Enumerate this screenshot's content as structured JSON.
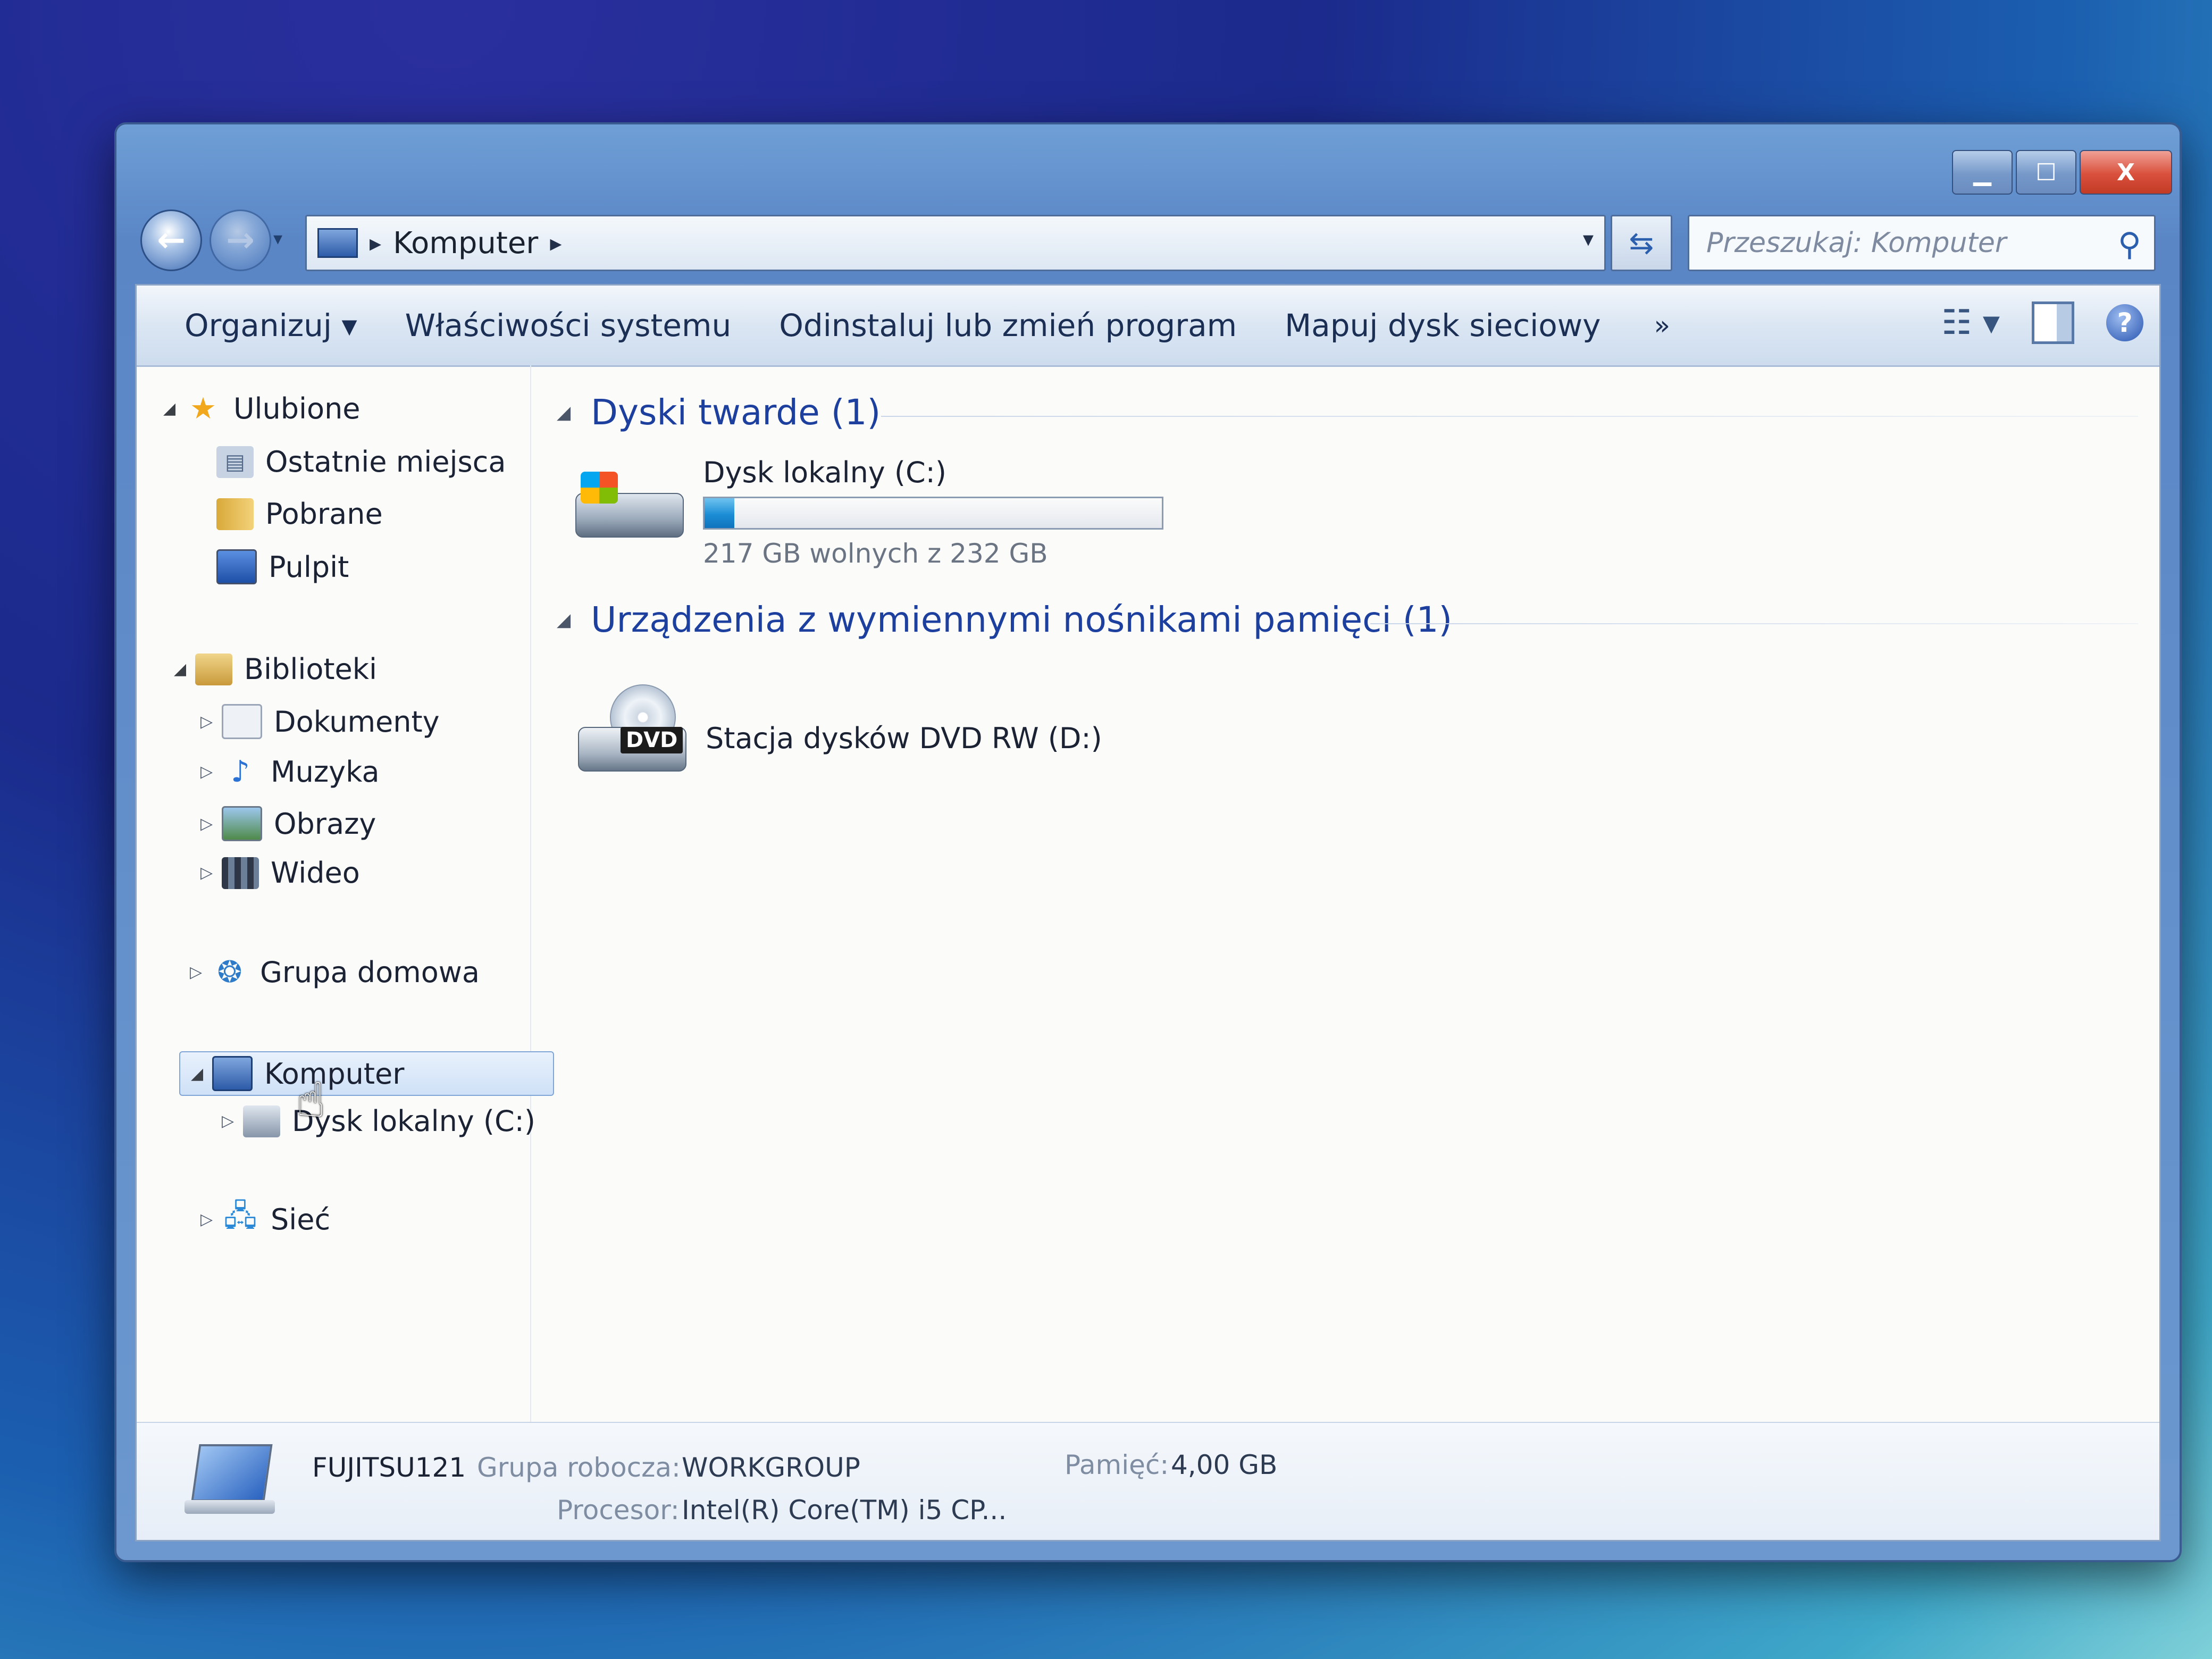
{
  "window": {
    "caption_buttons": {
      "minimize": "▁",
      "maximize": "☐",
      "close": "X"
    }
  },
  "navigation": {
    "back_glyph": "←",
    "forward_glyph": "→",
    "history_glyph": "▾",
    "breadcrumb_sep": "▸",
    "breadcrumb": [
      "Komputer"
    ],
    "dropdown_glyph": "▾",
    "refresh_glyph": "⇆",
    "search_placeholder": "Przeszukaj: Komputer",
    "search_icon_glyph": "⚲"
  },
  "toolbar": {
    "items": [
      "Organizuj ▾",
      "Właściwości systemu",
      "Odinstaluj lub zmień program",
      "Mapuj dysk sieciowy"
    ],
    "more_glyph": "»",
    "view_glyph": "☷ ▾",
    "help_glyph": "?"
  },
  "sidebar": {
    "favorites": {
      "label": "Ulubione",
      "items": [
        "Ostatnie miejsca",
        "Pobrane",
        "Pulpit"
      ]
    },
    "libraries": {
      "label": "Biblioteki",
      "items": [
        "Dokumenty",
        "Muzyka",
        "Obrazy",
        "Wideo"
      ]
    },
    "homegroup": "Grupa domowa",
    "computer": {
      "label": "Komputer",
      "items": [
        "Dysk lokalny (C:)"
      ]
    },
    "network": "Sieć",
    "tri_open": "◢",
    "tri_closed": "▷"
  },
  "main": {
    "hard_drives": {
      "header": "Dyski twarde (1)",
      "drive_name": "Dysk lokalny (C:)",
      "free_text": "217 GB wolnych z 232 GB",
      "used_fraction": 0.065,
      "bar_color": "#1c8ed6"
    },
    "removable": {
      "header": "Urządzenia z wymiennymi nośnikami pamięci (1)",
      "drive_name": "Stacja dysków DVD RW (D:)",
      "badge": "DVD"
    }
  },
  "details": {
    "computer_name": "FUJITSU121",
    "workgroup_label": "Grupa robocza:",
    "workgroup_value": "WORKGROUP",
    "memory_label": "Pamięć:",
    "memory_value": "4,00 GB",
    "processor_label": "Procesor:",
    "processor_value": "Intel(R) Core(TM) i5 CP..."
  },
  "colors": {
    "accent": "#1d3f9e",
    "selection": "#cfe1f7"
  },
  "icons": [
    "star-icon",
    "recent-places-icon",
    "downloads-icon",
    "desktop-icon",
    "libraries-icon",
    "documents-icon",
    "music-icon",
    "pictures-icon",
    "videos-icon",
    "homegroup-icon",
    "computer-icon",
    "drive-icon",
    "network-icon",
    "hdd-icon",
    "dvd-drive-icon",
    "hand-cursor-icon"
  ]
}
